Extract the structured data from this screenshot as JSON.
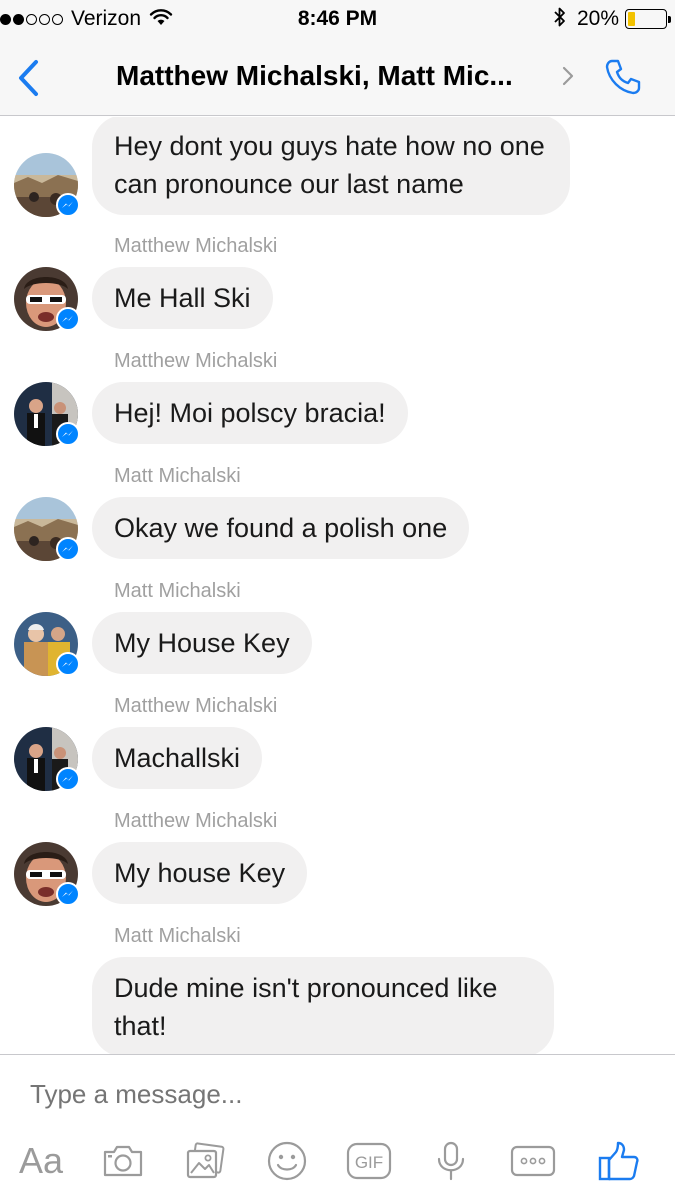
{
  "status_bar": {
    "carrier": "Verizon",
    "time": "8:46 PM",
    "battery_percent": "20%",
    "battery_level": 0.2,
    "signal_bars": 2,
    "battery_color": "#f2c200"
  },
  "nav": {
    "title": "Matthew Michalski, Matt Mic...",
    "back_icon": "chevron-left-icon",
    "call_icon": "phone-icon",
    "accent": "#1b7cf0"
  },
  "messages": [
    {
      "sender": "",
      "text": "Hey dont you guys hate how no one can pronounce our last name",
      "avatar": "avatar-landscape"
    },
    {
      "sender": "Matthew Michalski",
      "text": "Me Hall Ski",
      "avatar": "avatar-sunglasses"
    },
    {
      "sender": "Matthew Michalski",
      "text": "Hej! Moi polscy bracia!",
      "avatar": "avatar-suits"
    },
    {
      "sender": "Matt Michalski",
      "text": "Okay we found a polish one",
      "avatar": "avatar-landscape"
    },
    {
      "sender": "Matt Michalski",
      "text": "My House Key",
      "avatar": "avatar-group"
    },
    {
      "sender": "Matthew Michalski",
      "text": "Machallski",
      "avatar": "avatar-suits"
    },
    {
      "sender": "Matthew Michalski",
      "text": "My house Key",
      "avatar": "avatar-sunglasses"
    },
    {
      "sender": "Matt Michalski",
      "text": "Dude mine isn't pronounced like that!",
      "avatar": ""
    }
  ],
  "composer": {
    "placeholder": "Type a message...",
    "text_tool": "Aa",
    "gif_label": "GIF",
    "tools": [
      "text-format-icon",
      "camera-icon",
      "photo-gallery-icon",
      "emoji-icon",
      "gif-icon",
      "microphone-icon",
      "more-icon",
      "like-icon"
    ]
  },
  "colors": {
    "bubble": "#f1f0f0",
    "messenger_badge": "#0084ff",
    "sender_name": "#a0a0a0"
  }
}
